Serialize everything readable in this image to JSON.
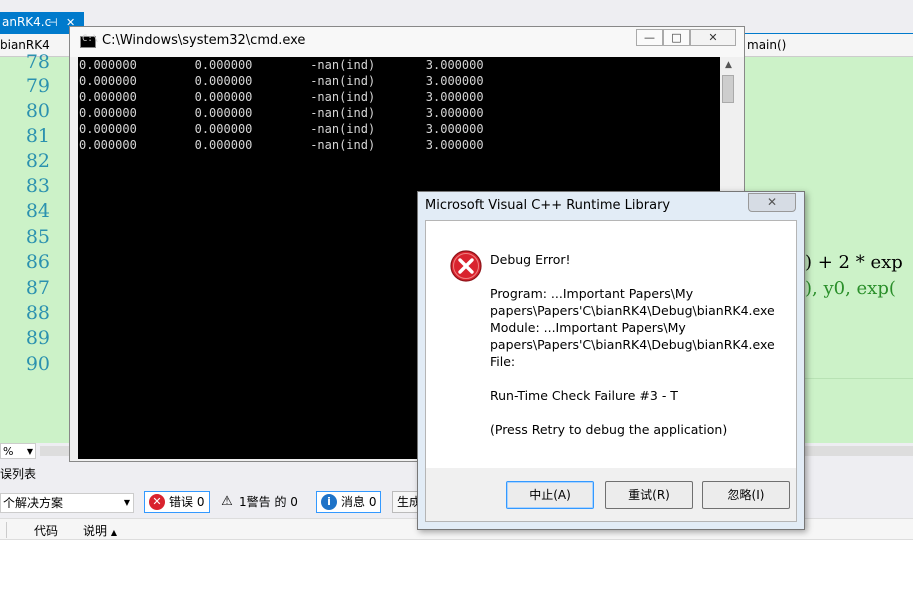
{
  "vs": {
    "tab_label": "anRK4.c",
    "tab_pin": "⊣",
    "tab_close": "✕",
    "nav_left": "bianRK4",
    "nav_right": "main()",
    "line_numbers": [
      "78",
      "79",
      "80",
      "81",
      "82",
      "83",
      "84",
      "85",
      "86",
      "87",
      "88",
      "89",
      "90"
    ],
    "code_fragments": {
      "line86": ") + 2 * exp",
      "line87": "), y0, exp("
    },
    "zoom": "%",
    "error_list": {
      "title": "误列表",
      "scope": "个解决方案",
      "errors": "错误 0",
      "warnings": "1警告 的 0",
      "messages": "消息 0",
      "build_label": "生成",
      "col_code": "代码",
      "col_desc": "说明"
    }
  },
  "cmd": {
    "title": "C:\\Windows\\system32\\cmd.exe",
    "minimize": "—",
    "maximize": "□",
    "close": "✕",
    "lines": [
      "0.000000        0.000000        -nan(ind)       3.000000",
      "0.000000        0.000000        -nan(ind)       3.000000",
      "0.000000        0.000000        -nan(ind)       3.000000",
      "0.000000        0.000000        -nan(ind)       3.000000",
      "0.000000        0.000000        -nan(ind)       3.000000",
      "0.000000        0.000000        -nan(ind)       3.000000"
    ]
  },
  "dialog": {
    "title": "Microsoft Visual C++ Runtime Library",
    "close": "✕",
    "heading": "Debug Error!",
    "program_1": "Program: ...Important Papers\\My",
    "program_2": "papers\\Papers'C\\bianRK4\\Debug\\bianRK4.exe",
    "module_1": "Module: ...Important Papers\\My",
    "module_2": "papers\\Papers'C\\bianRK4\\Debug\\bianRK4.exe",
    "file": "File:",
    "message": "Run-Time Check Failure #3 - T",
    "hint": "(Press Retry to debug the application)",
    "buttons": {
      "abort": "中止(A)",
      "retry": "重试(R)",
      "ignore": "忽略(I)"
    }
  },
  "colors": {
    "accent": "#007acc",
    "editor_bg": "#ccf2c8",
    "error_red": "#d9232e",
    "info_blue": "#1e73c8"
  }
}
